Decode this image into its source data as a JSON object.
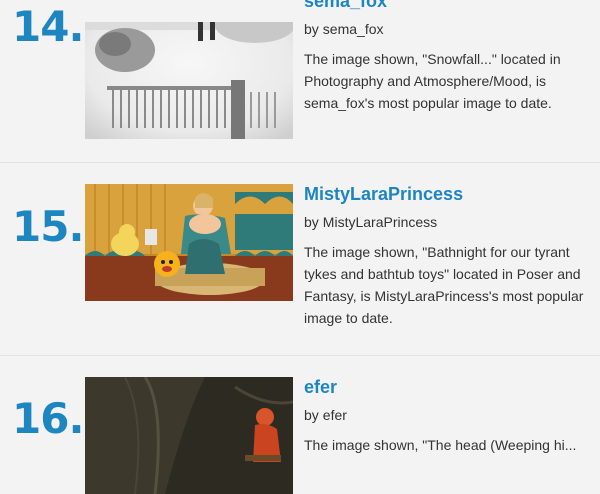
{
  "entries": [
    {
      "rank": "14.",
      "artist": "sema_fox",
      "by_text": "by",
      "by_name": "sema_fox",
      "description": "The image shown, \"Snowfall...\" located in Photography and Atmosphere/Mood, is sema_fox's most popular image to date."
    },
    {
      "rank": "15.",
      "artist": "MistyLaraPrincess",
      "by_text": "by",
      "by_name": "MistyLaraPrincess",
      "description": "The image shown, \"Bathnight for our tyrant tykes and bathtub toys\" located in Poser and Fantasy, is MistyLaraPrincess's most popular image to date."
    },
    {
      "rank": "16.",
      "artist": "efer",
      "by_text": "by",
      "by_name": "efer",
      "description": "The image shown, \"The head (Weeping hi..."
    }
  ],
  "colors": {
    "accent": "#1d86c0",
    "text": "#333333",
    "background": "#f3f3f3"
  }
}
